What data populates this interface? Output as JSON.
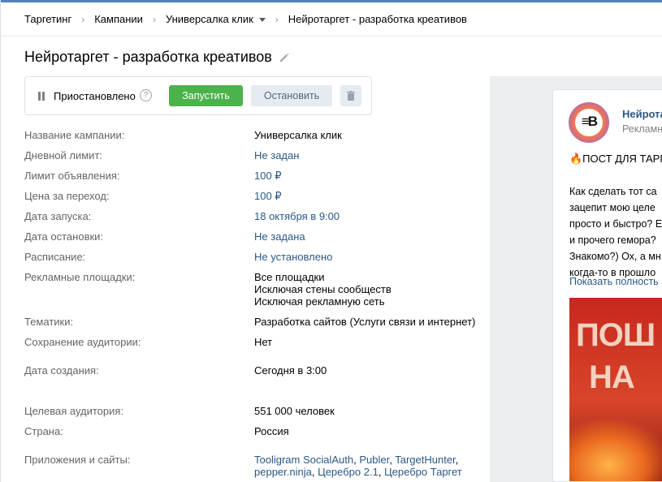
{
  "breadcrumb": {
    "items": [
      "Таргетинг",
      "Кампании",
      "Универсалка клик",
      "Нейротаргет - разработка креативов"
    ]
  },
  "page": {
    "title": "Нейротаргет - разработка креативов"
  },
  "status": {
    "label": "Приостановлено",
    "help": "?",
    "start_button": "Запустить",
    "stop_button": "Остановить"
  },
  "details": [
    {
      "label": "Название кампании:",
      "value": "Универсалка клик"
    },
    {
      "label": "Дневной лимит:",
      "value": "Не задан"
    },
    {
      "label": "Лимит объявления:",
      "value": "100 ₽"
    },
    {
      "label": "Цена за переход:",
      "value": "100 ₽"
    },
    {
      "label": "Дата запуска:",
      "value": "18 октября в 9:00"
    },
    {
      "label": "Дата остановки:",
      "value": "Не задана"
    },
    {
      "label": "Расписание:",
      "value": "Не установлено"
    },
    {
      "label": "Рекламные площадки:",
      "value": [
        "Все площадки",
        "Исключая стены сообществ",
        "Исключая рекламную сеть"
      ]
    },
    {
      "label": "Тематики:",
      "value": "Разработка сайтов (Услуги связи и интернет)"
    },
    {
      "label": "Сохранение аудитории:",
      "value": "Нет"
    },
    {
      "label": "Дата создания:",
      "value": "Сегодня в 3:00"
    },
    {
      "label": "Целевая аудитория:",
      "value": "551 000 человек"
    },
    {
      "label": "Страна:",
      "value": "Россия"
    },
    {
      "label": "Приложения и сайты:",
      "value": [
        "Tooligram SocialAuth",
        "Publer",
        "TargetHunter",
        "pepper.ninja",
        "Церебро 2.1",
        "Церебро Таргет"
      ]
    }
  ],
  "preview": {
    "group_name": "Нейрота",
    "group_sub": "Рекламн",
    "headline": "🔥ПОСТ ДЛЯ ТАРГ",
    "text_lines": [
      "Как сделать тот са",
      "зацепит мою целе",
      "просто и быстро? Е",
      "и прочего гемора?",
      "Знакомо?) Ох, а мн",
      "когда-то в прошло"
    ],
    "show_more": "Показать полность",
    "image_text": [
      "ПОШ",
      "НА"
    ]
  },
  "colors": {
    "link": "#2a5885",
    "start_green": "#4bb34b",
    "secondary_button": "#e5ebf1",
    "label_gray": "#656565"
  },
  "icons": [
    "pause-icon",
    "help-icon",
    "pencil-icon",
    "trash-icon",
    "chevron-down-icon"
  ]
}
